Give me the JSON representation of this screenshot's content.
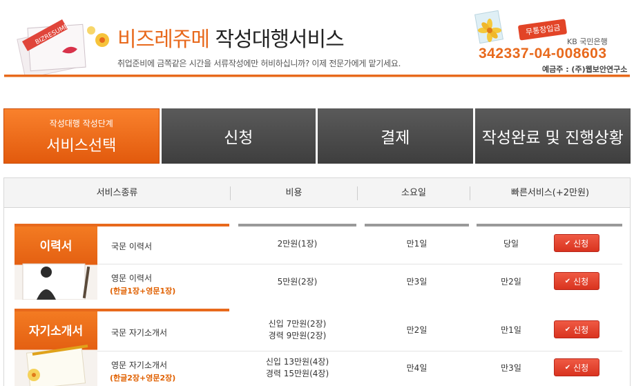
{
  "header": {
    "brand_part1": "비즈레쥬메",
    "brand_part2": " 작성대행서비스",
    "tagline": "취업준비에 금쪽같은 시간을 서류작성에만 허비하십니까?  이제 전문가에게 맡기세요.",
    "logo_text": "BIZRESUME",
    "deposit_tag": "무통장입금",
    "bank_name": "KB 국민은행",
    "account_number": "342337-04-008603",
    "account_holder": "예금주 : (주)웹보안연구소"
  },
  "steps": [
    {
      "small": "작성대행 작성단계",
      "label": "서비스선택",
      "active": true
    },
    {
      "label": "신청",
      "active": false
    },
    {
      "label": "결제",
      "active": false
    },
    {
      "label": "작성완료 및 진행상황",
      "active": false
    }
  ],
  "table": {
    "headers": [
      "서비스종류",
      "비용",
      "소요일",
      "빠른서비스(+2만원)"
    ],
    "apply_label": "신청",
    "sections": [
      {
        "title": "이력서",
        "rows": [
          {
            "name": "국문 이력서",
            "note": "",
            "cost": [
              "2만원(1장)"
            ],
            "days": "만1일",
            "fast_days": "당일"
          },
          {
            "name": "영문 이력서",
            "note": "(한글1장+영문1장)",
            "cost": [
              "5만원(2장)"
            ],
            "days": "만3일",
            "fast_days": "만2일"
          }
        ]
      },
      {
        "title": "자기소개서",
        "rows": [
          {
            "name": "국문 자기소개서",
            "note": "",
            "cost": [
              "신입 7만원(2장)",
              "경력 9만원(2장)"
            ],
            "days": "만2일",
            "fast_days": "만1일"
          },
          {
            "name": "영문 자기소개서",
            "note": "(한글2장+영문2장)",
            "cost": [
              "신입 13만원(4장)",
              "경력 15만원(4장)"
            ],
            "days": "만4일",
            "fast_days": "만3일"
          }
        ]
      }
    ]
  },
  "colors": {
    "accent": "#e8691c",
    "dark_tab": "#4a4a4a",
    "button_red": "#e2412c"
  }
}
